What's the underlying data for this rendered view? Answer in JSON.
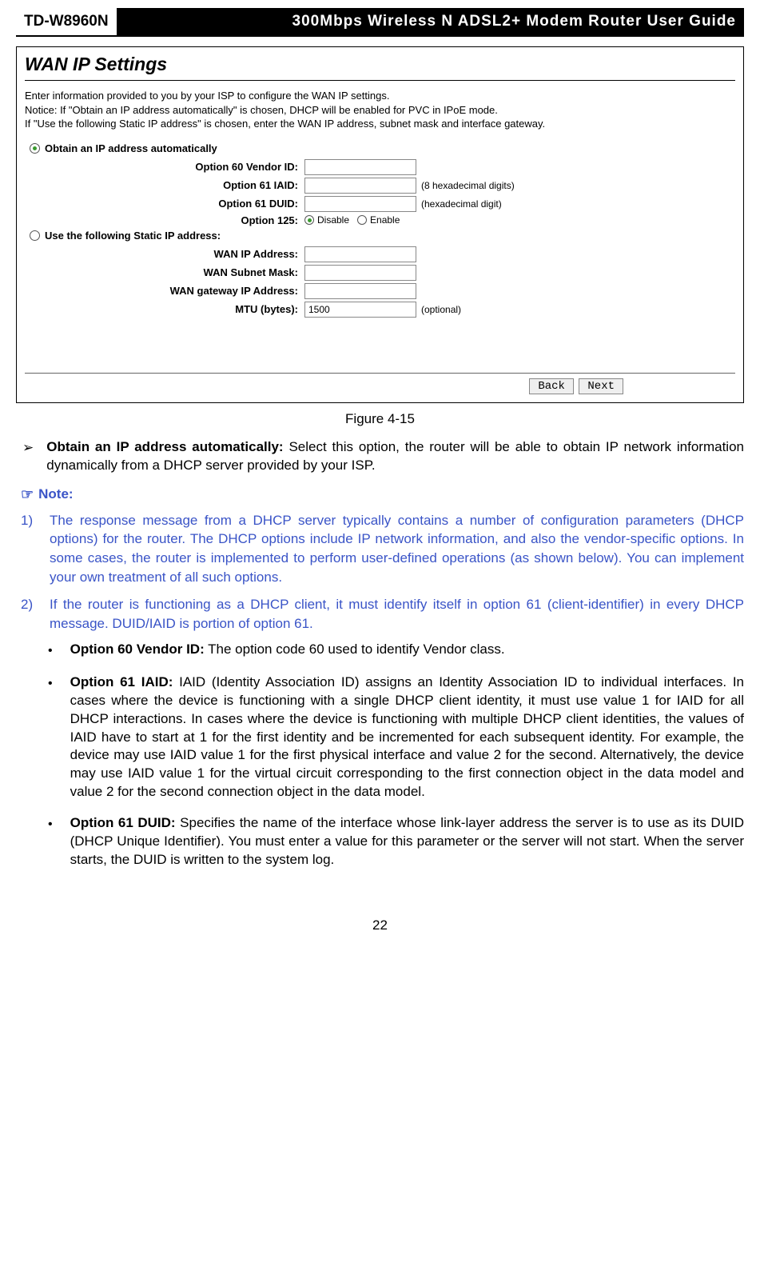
{
  "header": {
    "model": "TD-W8960N",
    "title": "300Mbps Wireless N ADSL2+ Modem Router User Guide"
  },
  "figure": {
    "title": "WAN IP Settings",
    "intro_l1": "Enter information provided to you by your ISP to configure the WAN IP settings.",
    "intro_l2": "Notice: If \"Obtain an IP address automatically\" is chosen, DHCP will be enabled for PVC in IPoE mode.",
    "intro_l3": "If \"Use the following Static IP address\" is chosen, enter the WAN IP address, subnet mask and interface gateway.",
    "radio_auto": "Obtain an IP address automatically",
    "radio_static": "Use the following Static IP address:",
    "opt60_label": "Option 60 Vendor ID:",
    "opt61iaid_label": "Option 61 IAID:",
    "opt61iaid_suffix": "(8 hexadecimal digits)",
    "opt61duid_label": "Option 61 DUID:",
    "opt61duid_suffix": "(hexadecimal digit)",
    "opt125_label": "Option 125:",
    "opt125_disable": "Disable",
    "opt125_enable": "Enable",
    "wanip_label": "WAN IP Address:",
    "wanmask_label": "WAN Subnet Mask:",
    "wangw_label": "WAN gateway IP Address:",
    "mtu_label": "MTU (bytes):",
    "mtu_value": "1500",
    "mtu_suffix": "(optional)",
    "btn_back": "Back",
    "btn_next": "Next",
    "caption": "Figure 4-15"
  },
  "bullets": {
    "obtain_bold": "Obtain an IP address automatically:",
    "obtain_rest": " Select this option, the router will be able to obtain IP network information dynamically from a DHCP server provided by your ISP."
  },
  "note": {
    "label": "Note:",
    "n1_num": "1)",
    "n1": "The response message from a DHCP server typically contains a number of configuration parameters (DHCP options) for the router. The DHCP options include IP network information, and also the vendor-specific options. In some cases, the router is implemented to perform user-defined operations (as shown below). You can implement your own treatment of all such options.",
    "n2_num": "2)",
    "n2": "If the router is functioning as a DHCP client, it must identify itself in option 61 (client-identifier) in every DHCP message. DUID/IAID is portion of option 61."
  },
  "opts": {
    "o60_b": "Option 60 Vendor ID:",
    "o60_r": " The option code 60 used to identify Vendor class.",
    "o61i_b": "Option 61 IAID:",
    "o61i_r": " IAID (Identity Association ID) assigns an Identity Association ID to individual interfaces. In cases where the device is functioning with a single DHCP client identity, it must use value 1 for IAID for all DHCP interactions. In cases where the device is functioning with multiple DHCP client identities, the values of IAID have to start at 1 for the first identity and be incremented for each subsequent identity. For example, the device may use IAID value 1 for the first physical interface and value 2 for the second. Alternatively, the device may use IAID value 1 for the virtual circuit corresponding to the first connection object in the data model and value 2 for the second connection object in the data model.",
    "o61d_b": "Option 61 DUID:",
    "o61d_r": " Specifies the name of the interface whose link-layer address the server is to use as its DUID (DHCP Unique Identifier). You must enter a value for this parameter or the server will not start. When the server starts, the DUID is written to the system log."
  },
  "page_number": "22"
}
